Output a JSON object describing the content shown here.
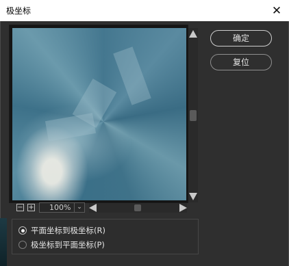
{
  "window": {
    "title": "极坐标",
    "close_glyph": "✕"
  },
  "buttons": {
    "ok_label": "确定",
    "reset_label": "复位"
  },
  "preview": {
    "zoom_level": "100%",
    "zoom_out_glyph": "−",
    "zoom_in_glyph": "+",
    "dropdown_glyph": "⌄"
  },
  "options": {
    "items": [
      {
        "label": "平面坐标到极坐标(R)",
        "selected": true
      },
      {
        "label": "极坐标到平面坐标(P)",
        "selected": false
      }
    ]
  },
  "colors": {
    "dialog_bg": "#2f2f2f",
    "button_border": "#cfcfcf"
  }
}
